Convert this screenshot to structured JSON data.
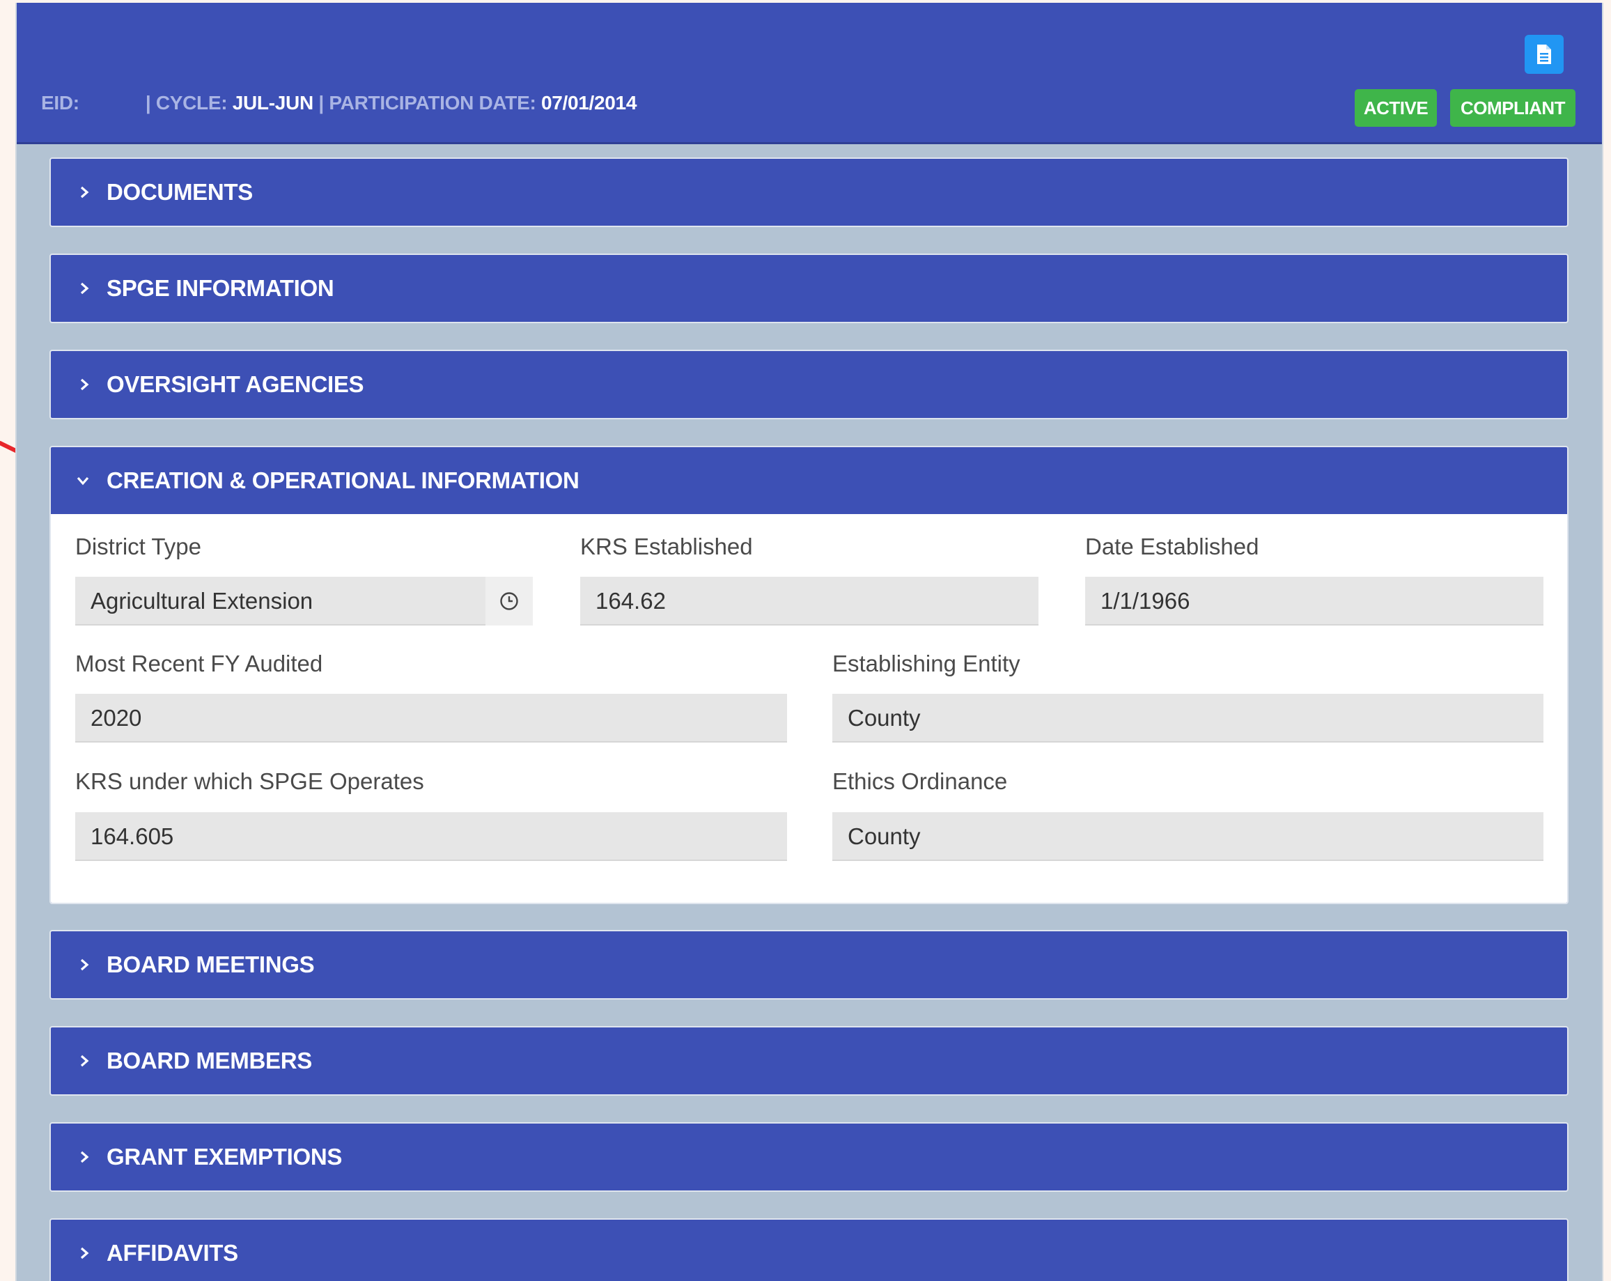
{
  "header": {
    "eid_label": "EID:",
    "eid_value": "",
    "cycle_label": "| CYCLE:",
    "cycle_value": "JUL-JUN",
    "participation_label": "| PARTICIPATION DATE:",
    "participation_value": "07/01/2014",
    "document_icon": "document-icon",
    "badges": {
      "active": "ACTIVE",
      "compliant": "COMPLIANT"
    }
  },
  "panels": {
    "documents": "DOCUMENTS",
    "spge_information": "SPGE INFORMATION",
    "oversight_agencies": "OVERSIGHT AGENCIES",
    "creation": "CREATION & OPERATIONAL INFORMATION",
    "board_meetings": "BOARD MEETINGS",
    "board_members": "BOARD MEMBERS",
    "grant_exemptions": "GRANT EXEMPTIONS",
    "affidavits": "AFFIDAVITS"
  },
  "creation_fields": {
    "district_type": {
      "label": "District Type",
      "value": "Agricultural Extension"
    },
    "krs_established": {
      "label": "KRS Established",
      "value": "164.62"
    },
    "date_established": {
      "label": "Date Established",
      "value": "1/1/1966"
    },
    "most_recent_fy_audited": {
      "label": "Most Recent FY Audited",
      "value": "2020"
    },
    "establishing_entity": {
      "label": "Establishing Entity",
      "value": "County"
    },
    "krs_operates": {
      "label": "KRS under which SPGE Operates",
      "value": "164.605"
    },
    "ethics_ordinance": {
      "label": "Ethics Ordinance",
      "value": "County"
    }
  },
  "colors": {
    "header_bg": "#3d50b5",
    "panel_bg": "#3d50b5",
    "badge_green": "#3fb54a",
    "frame_bg": "#b3c3d3",
    "annotation_arrow": "#e8262b"
  },
  "icons": {
    "collapsed": "chevron-right-icon",
    "expanded": "chevron-down-icon",
    "history": "clock-icon"
  }
}
